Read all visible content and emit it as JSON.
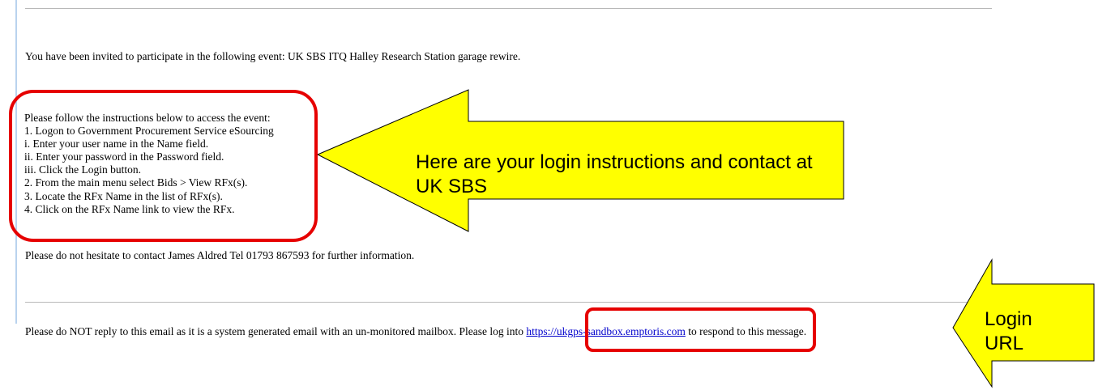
{
  "email": {
    "invite_text": "You have been invited to participate in the following event: UK SBS ITQ Halley Research Station garage rewire.",
    "instructions": [
      "Please follow the instructions below to access the event:",
      "1. Logon to Government Procurement Service eSourcing",
      "i. Enter your user name in the Name field.",
      "ii. Enter your password in the Password field.",
      "iii. Click the Login button.",
      "2. From the main menu select Bids > View RFx(s).",
      "3. Locate the RFx Name in the list of RFx(s).",
      "4. Click on the RFx Name link to view the RFx."
    ],
    "contact_text": "Please do not hesitate to contact James Aldred Tel 01793 867593 for further information.",
    "footer_before": "Please do NOT reply to this email as it is a system generated email with an un-monitored mailbox. Please log into ",
    "footer_link": "https://ukgps-sandbox.emptoris.com",
    "footer_after": " to respond to this message."
  },
  "callouts": {
    "main": "Here are your login instructions and contact at UK SBS",
    "url": "Login URL"
  },
  "colors": {
    "highlight_red": "#e60000",
    "callout_yellow": "#ffff00",
    "link_blue": "#0000cc"
  }
}
